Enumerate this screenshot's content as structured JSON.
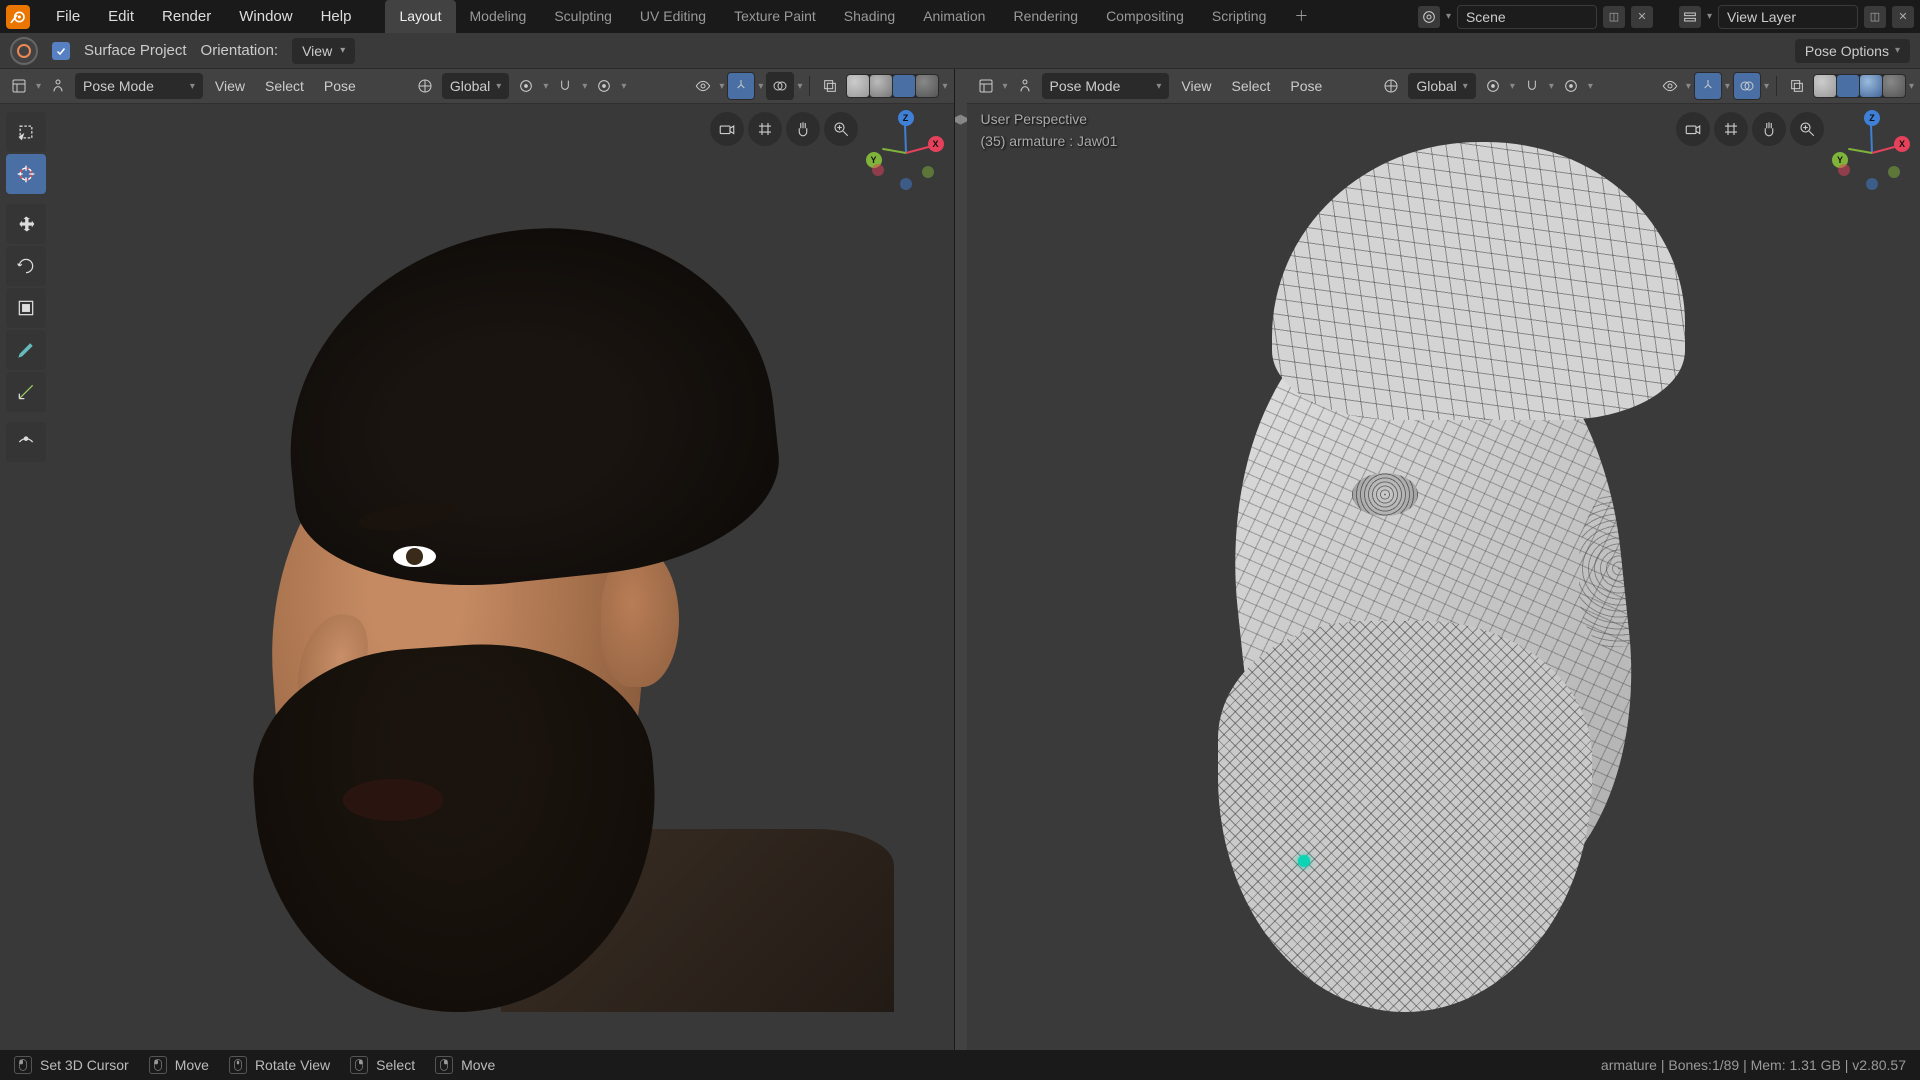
{
  "app": {
    "menus": [
      "File",
      "Edit",
      "Render",
      "Window",
      "Help"
    ],
    "workspaces": [
      "Layout",
      "Modeling",
      "Sculpting",
      "UV Editing",
      "Texture Paint",
      "Shading",
      "Animation",
      "Rendering",
      "Compositing",
      "Scripting"
    ],
    "active_workspace": "Layout",
    "scene_name": "Scene",
    "view_layer": "View Layer"
  },
  "tool_settings": {
    "surface_project_checked": true,
    "surface_project_label": "Surface Project",
    "orientation_label": "Orientation:",
    "orientation_value": "View",
    "pose_options_label": "Pose Options"
  },
  "viewport_header": {
    "mode": "Pose Mode",
    "menus": [
      "View",
      "Select",
      "Pose"
    ],
    "transform_orientation": "Global"
  },
  "right_overlay": {
    "perspective": "User Perspective",
    "object_info": "(35) armature : Jaw01"
  },
  "status": {
    "action1": "Set 3D Cursor",
    "action2": "Move",
    "action3": "Rotate View",
    "action4": "Select",
    "action5": "Move",
    "right": "armature | Bones:1/89 | Mem: 1.31 GB | v2.80.57"
  },
  "axes": {
    "x": "X",
    "y": "Y",
    "z": "Z"
  }
}
